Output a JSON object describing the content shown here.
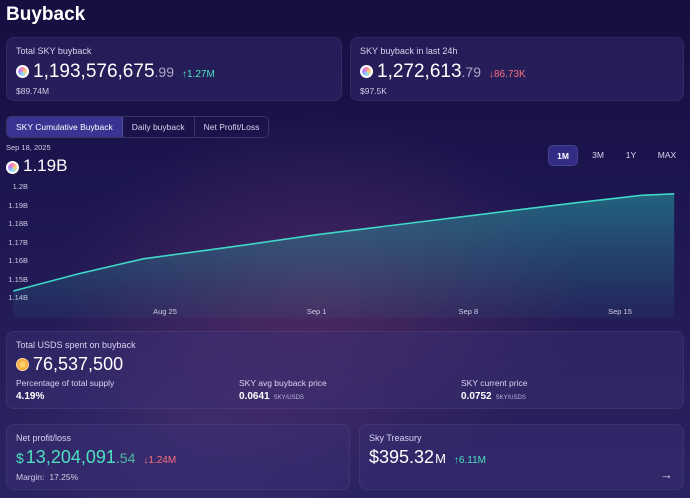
{
  "page": {
    "title": "Buyback"
  },
  "total_card": {
    "label": "Total SKY buyback",
    "value_int": "1,193,576,675",
    "value_dec": ".99",
    "change": "↑1.27M",
    "usd": "$89.74M"
  },
  "last24_card": {
    "label": "SKY buyback in last 24h",
    "value_int": "1,272,613",
    "value_dec": ".79",
    "change": "↓86.73K",
    "usd": "$97.5K"
  },
  "tabs": [
    {
      "label": "SKY Cumulative Buyback",
      "active": true
    },
    {
      "label": "Daily buyback",
      "active": false
    },
    {
      "label": "Net Profit/Loss",
      "active": false
    }
  ],
  "chart_header": {
    "date": "Sep 18, 2025",
    "value": "1.19B"
  },
  "range_buttons": [
    "1M",
    "3M",
    "1Y",
    "MAX"
  ],
  "chart_data": {
    "type": "area",
    "y_ticks": [
      "1.2B",
      "1.19B",
      "1.18B",
      "1.17B",
      "1.16B",
      "1.15B",
      "1.14B"
    ],
    "x_ticks": [
      "Aug 25",
      "Sep 1",
      "Sep 8",
      "Sep 15"
    ],
    "ylim": [
      1.14,
      1.2
    ],
    "x_day_range": [
      0,
      28
    ],
    "x_tick_days": [
      7,
      14,
      21,
      28
    ],
    "points": [
      {
        "x": 0,
        "y": 1.1438
      },
      {
        "x": 3,
        "y": 1.153
      },
      {
        "x": 6,
        "y": 1.1612
      },
      {
        "x": 10,
        "y": 1.1675
      },
      {
        "x": 14,
        "y": 1.1742
      },
      {
        "x": 18,
        "y": 1.18
      },
      {
        "x": 22,
        "y": 1.1858
      },
      {
        "x": 26,
        "y": 1.1915
      },
      {
        "x": 29,
        "y": 1.1955
      },
      {
        "x": 30.5,
        "y": 1.1963
      }
    ],
    "line_color": "#3fd8c8",
    "grid": false
  },
  "usds_card": {
    "label": "Total USDS spent on buyback",
    "value": "76,537,500",
    "stats": [
      {
        "label": "Percentage of total supply",
        "value": "4.19%",
        "unit": ""
      },
      {
        "label": "SKY avg buyback price",
        "value": "0.0641",
        "unit": "SKY/USDS"
      },
      {
        "label": "SKY current price",
        "value": "0.0752",
        "unit": "SKY/USDS"
      }
    ]
  },
  "pnl_card": {
    "label": "Net profit/loss",
    "prefix": "$",
    "value_int": "13,204,091",
    "value_dec": ".54",
    "change": "↓1.24M",
    "margin_label": "Margin:",
    "margin_value": "17.25%"
  },
  "treasury_card": {
    "label": "Sky Treasury",
    "value": "$395.32",
    "suffix": "M",
    "change": "↑6.11M",
    "arrow": "→"
  },
  "colors": {
    "accent": "#3b3392",
    "up": "#4fe0c0",
    "down": "#ff6e7e",
    "pnl_value": "#4fe0c0"
  }
}
